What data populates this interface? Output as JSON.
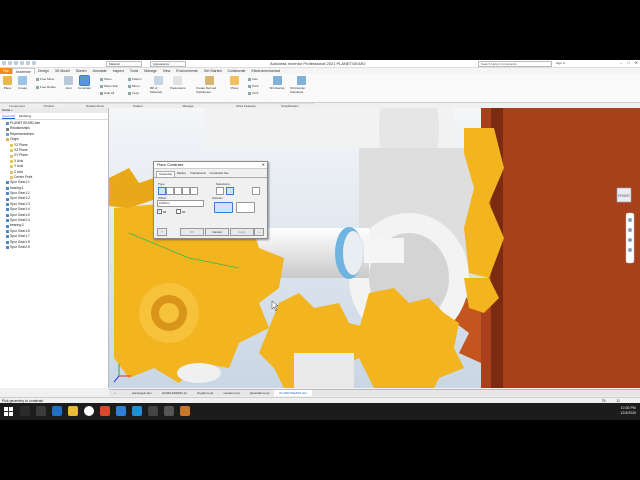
{
  "title_bar": {
    "material_value": "Material",
    "appearance_value": "Appearance",
    "app_title": "Autodesk Inventor Professional 2021   PLANETGEAR2",
    "search_placeholder": "Search Help & Commands...",
    "signin_label": "Sign In"
  },
  "ribbon_tabs": [
    "File",
    "Assemble",
    "Design",
    "3D Model",
    "Sketch",
    "Annotate",
    "Inspect",
    "Tools",
    "Manage",
    "View",
    "Environments",
    "Get Started",
    "Collaborate",
    "Electromechanical"
  ],
  "ribbon": {
    "place_label": "Place",
    "create_label": "Create",
    "free_move_label": "Free Move",
    "free_rotate_label": "Free Rotate",
    "joint_label": "Joint",
    "constrain_label": "Constrain",
    "show_label": "Show",
    "show_sick_label": "Show Sick",
    "hide_all_label": "Hide All",
    "pattern_label": "Pattern",
    "mirror_label": "Mirror",
    "copy_label": "Copy",
    "bill_of_materials_label": "Bill of Materials",
    "parameters_label": "Parameters",
    "create_derived_label": "Create Derived Substitutes",
    "plane_label": "Plane",
    "axis_label": "Axis",
    "point_label": "Point",
    "ucs_label": "UCS",
    "shrinkwrap_label": "Shrinkwrap",
    "shrinkwrap_sub_label": "Shrinkwrap Substitute",
    "panel_component": "Component",
    "panel_position": "Position",
    "panel_relationships": "Relationships",
    "panel_pattern": "Pattern",
    "panel_manage": "Manage",
    "panel_productivity": "Productivity",
    "panel_work_features": "Work Features",
    "panel_simplification": "Simplification"
  },
  "browser": {
    "header": "Model  +",
    "tabs": [
      "Assembly",
      "Modeling"
    ],
    "nodes": [
      {
        "label": "PLANETGEAR2.iam",
        "color": "#5c88c6"
      },
      {
        "label": "Relationships",
        "color": "#7a7a7a"
      },
      {
        "label": "Representations",
        "color": "#6a9fd8"
      },
      {
        "label": "Origin",
        "color": "#d9b04a"
      },
      {
        "label": "YZ Plane",
        "color": "#e3c36a"
      },
      {
        "label": "XZ Plane",
        "color": "#e3c36a"
      },
      {
        "label": "XY Plane",
        "color": "#e3c36a"
      },
      {
        "label": "X Axis",
        "color": "#e3c36a"
      },
      {
        "label": "Y Axis",
        "color": "#e3c36a"
      },
      {
        "label": "Z Axis",
        "color": "#e3c36a"
      },
      {
        "label": "Center Point",
        "color": "#e3c36a"
      },
      {
        "label": "Spur Gear1:1",
        "color": "#4a86c8"
      },
      {
        "label": "bearing:1",
        "color": "#4a86c8"
      },
      {
        "label": "Spur Gear1:1",
        "color": "#4a86c8"
      },
      {
        "label": "Spur Gear1:2",
        "color": "#4a86c8"
      },
      {
        "label": "Spur Gear1:3",
        "color": "#4a86c8"
      },
      {
        "label": "Spur Gear1:4",
        "color": "#4a86c8"
      },
      {
        "label": "Spur Gear1:5",
        "color": "#4a86c8"
      },
      {
        "label": "Spur Gear2:4",
        "color": "#4a86c8"
      },
      {
        "label": "bearing:2",
        "color": "#4a86c8"
      },
      {
        "label": "Spur Gear1:6",
        "color": "#4a86c8"
      },
      {
        "label": "Spur Gear1:7",
        "color": "#4a86c8"
      },
      {
        "label": "Spur Gear1:8",
        "color": "#4a86c8"
      },
      {
        "label": "Spur Gear2:5",
        "color": "#4a86c8"
      }
    ]
  },
  "dialog": {
    "title": "Place Constraint",
    "tabs": [
      "Assembly",
      "Motion",
      "Transitional",
      "Constraint Set"
    ],
    "type_label": "Type",
    "selections_label": "Selections",
    "offset_label": "Offset:",
    "offset_value": "0.000 in",
    "solution_label": "Solution",
    "ok_label": "OK",
    "cancel_label": "Cancel",
    "apply_label": "Apply"
  },
  "doc_tabs": [
    "planetgear.iam",
    "HANDLEDEMO.ipt",
    "ringdemo.ipt",
    "sundemo.ipt",
    "planetdemo.ipt",
    "PLANETGEAR2.iam"
  ],
  "status": {
    "message": "Pick geometry to constrain",
    "numbers": "75   11"
  },
  "taskbar": {
    "time": "10:30 PM",
    "date": "12/3/2020"
  },
  "colors": {
    "gear_gold": "#f2b41f",
    "bearing_white": "#eeeeee",
    "ring_brown": "#a8401c",
    "shaft_blue": "#6fb4e0",
    "file_tab": "#f08c1e",
    "accent_blue": "#1a64c8"
  }
}
